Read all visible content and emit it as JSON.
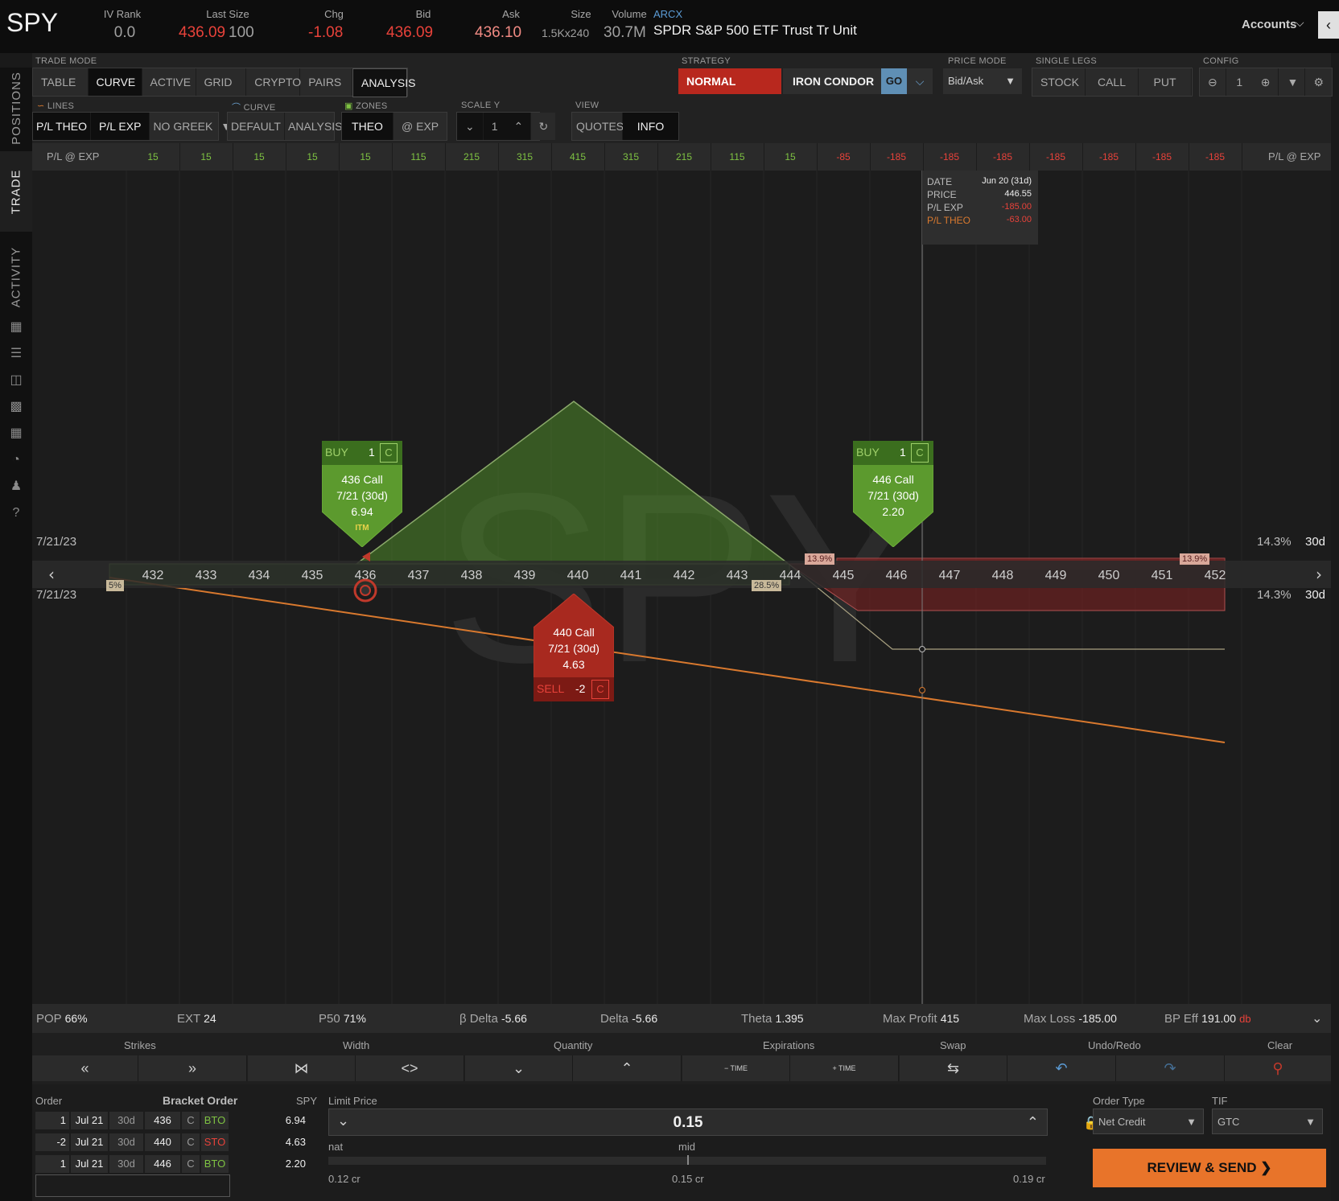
{
  "header": {
    "symbol": "SPY",
    "iv_rank_label": "IV Rank",
    "iv_rank": "0.0",
    "last_size_label": "Last Size",
    "last": "436.09",
    "last_size": "100",
    "chg_label": "Chg",
    "chg": "-1.08",
    "bid_label": "Bid",
    "bid": "436.09",
    "ask_label": "Ask",
    "ask": "436.10",
    "size_label": "Size",
    "size": "1.5Kx240",
    "volume_label": "Volume",
    "volume": "30.7M",
    "exchange": "ARCX",
    "description": "SPDR S&P 500 ETF Trust Tr Unit",
    "accounts_label": "Accounts"
  },
  "rail": {
    "tabs": [
      "POSITIONS",
      "TRADE",
      "ACTIVITY"
    ]
  },
  "toolbar": {
    "trade_mode_label": "TRADE MODE",
    "trade_modes": [
      "TABLE",
      "CURVE",
      "ACTIVE",
      "GRID",
      "CRYPTO",
      "PAIRS",
      "ANALYSIS"
    ],
    "strategy_label": "STRATEGY",
    "strategy_normal": "NORMAL",
    "strategy_name": "IRON CONDOR",
    "go_label": "GO",
    "price_mode_label": "PRICE MODE",
    "price_mode": "Bid/Ask",
    "single_legs_label": "SINGLE LEGS",
    "single_legs": [
      "STOCK",
      "CALL",
      "PUT"
    ],
    "config_label": "CONFIG",
    "config_value": "1",
    "lines_label": "LINES",
    "lines": [
      "P/L THEO",
      "P/L EXP"
    ],
    "greek": "NO GREEK",
    "curve_label": "CURVE",
    "curves": [
      "DEFAULT",
      "ANALYSIS"
    ],
    "zones_label": "ZONES",
    "zones": [
      "THEO",
      "@ EXP"
    ],
    "scale_label": "SCALE Y",
    "scale_value": "1",
    "view_label": "VIEW",
    "views": [
      "QUOTES",
      "INFO"
    ]
  },
  "pnl_row": {
    "label": "P/L @ EXP",
    "values": [
      "15",
      "15",
      "15",
      "15",
      "15",
      "115",
      "215",
      "315",
      "415",
      "315",
      "215",
      "115",
      "15",
      "-85",
      "-185",
      "-185",
      "-185",
      "-185",
      "-185",
      "-185",
      "-185"
    ]
  },
  "chart": {
    "date_left": "7/21/23",
    "iv": "14.3%",
    "dte": "30d",
    "strikes": [
      "432",
      "433",
      "434",
      "435",
      "436",
      "437",
      "438",
      "439",
      "440",
      "441",
      "442",
      "443",
      "444",
      "445",
      "446",
      "447",
      "448",
      "449",
      "450",
      "451",
      "452"
    ],
    "prob_left": "5%",
    "prob_mid": "28.5%",
    "prob_right1": "13.9%",
    "prob_right2": "13.9%",
    "watermark": "SPY",
    "info": {
      "date_label": "DATE",
      "date": "Jun 20 (31d)",
      "price_label": "PRICE",
      "price": "446.55",
      "plexp_label": "P/L EXP",
      "plexp": "-185.00",
      "pltheo_label": "P/L THEO",
      "pltheo": "-63.00"
    },
    "legs": [
      {
        "action": "BUY",
        "qty": "1",
        "type": "C",
        "name": "436 Call",
        "exp": "7/21 (30d)",
        "price": "6.94",
        "tag": "ITM"
      },
      {
        "action": "SELL",
        "qty": "-2",
        "type": "C",
        "name": "440 Call",
        "exp": "7/21 (30d)",
        "price": "4.63"
      },
      {
        "action": "BUY",
        "qty": "1",
        "type": "C",
        "name": "446 Call",
        "exp": "7/21 (30d)",
        "price": "2.20"
      }
    ],
    "colors": {
      "profit": "#4e8a2a",
      "loss": "#7a2222",
      "theo": "#d9792e"
    }
  },
  "stats": {
    "pop_label": "POP",
    "pop": "66%",
    "ext_label": "EXT",
    "ext": "24",
    "p50_label": "P50",
    "p50": "71%",
    "bdelta_label": "β Delta",
    "bdelta": "-5.66",
    "delta_label": "Delta",
    "delta": "-5.66",
    "theta_label": "Theta",
    "theta": "1.395",
    "maxprofit_label": "Max Profit",
    "maxprofit": "415",
    "maxloss_label": "Max Loss",
    "maxloss": "-185.00",
    "bpeff_label": "BP Eff",
    "bpeff": "191.00",
    "bpeff_suffix": "db"
  },
  "controls": {
    "labels": [
      "Strikes",
      "Width",
      "Quantity",
      "Expirations",
      "Swap",
      "Undo/Redo",
      "Clear"
    ],
    "time_label": "TIME"
  },
  "order": {
    "order_label": "Order",
    "bracket_label": "Bracket Order",
    "spy_label": "SPY",
    "rows": [
      {
        "qty": "1",
        "exp": "Jul 21",
        "dte": "30d",
        "strike": "436",
        "type": "C",
        "action": "BTO",
        "price": "6.94"
      },
      {
        "qty": "-2",
        "exp": "Jul 21",
        "dte": "30d",
        "strike": "440",
        "type": "C",
        "action": "STO",
        "price": "4.63"
      },
      {
        "qty": "1",
        "exp": "Jul 21",
        "dte": "30d",
        "strike": "446",
        "type": "C",
        "action": "BTO",
        "price": "2.20"
      }
    ],
    "limit_label": "Limit Price",
    "limit_value": "0.15",
    "nat_label": "nat",
    "mid_label": "mid",
    "range_low": "0.12 cr",
    "range_mid": "0.15 cr",
    "range_high": "0.19 cr",
    "order_type_label": "Order Type",
    "order_type": "Net Credit",
    "tif_label": "TIF",
    "tif": "GTC",
    "review_label": "REVIEW & SEND"
  }
}
